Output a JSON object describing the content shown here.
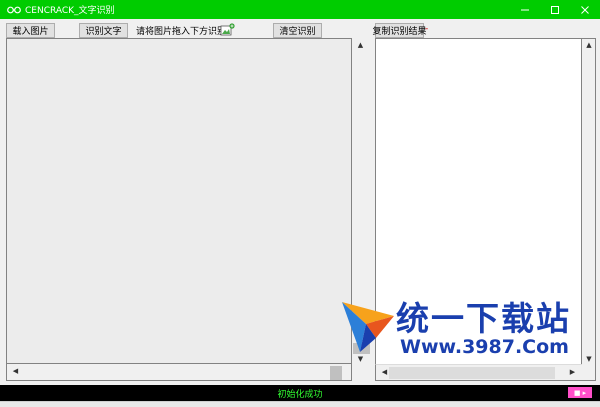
{
  "window": {
    "title": "CENCRACK_文字识别",
    "app_icon": "glasses-icon",
    "accent": "#00cc00"
  },
  "toolbar": {
    "load_image_label": "载入图片",
    "recognize_label": "识别文字",
    "drag_hint": "请将图片拖入下方识别!",
    "drag_hint_icon": "image-drop-icon",
    "clear_label": "清空识别",
    "copy_result_label": "复制识别结果"
  },
  "watermark": {
    "title": "统一下载站",
    "url": "Www.3987.Com"
  },
  "status": {
    "text": "初始化成功",
    "color": "#33ff33"
  }
}
